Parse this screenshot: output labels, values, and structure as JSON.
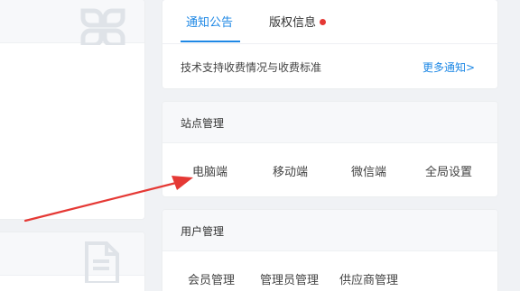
{
  "notice": {
    "tabs": [
      {
        "label": "通知公告",
        "active": true
      },
      {
        "label": "版权信息",
        "has_dot": true
      }
    ],
    "text": "技术支持收费情况与收费标准",
    "more_label": "更多通知>"
  },
  "site_management": {
    "title": "站点管理",
    "items": [
      "电脑端",
      "移动端",
      "微信端",
      "全局设置"
    ]
  },
  "user_management": {
    "title": "用户管理",
    "items": [
      "会员管理",
      "管理员管理",
      "供应商管理"
    ]
  },
  "icons": {
    "top_card": "grid-icon",
    "bottom_card": "document-icon"
  },
  "colors": {
    "accent": "#1e88e5",
    "dot": "#e53935",
    "annotation_arrow": "#e53935",
    "background": "#f0f2f5"
  }
}
